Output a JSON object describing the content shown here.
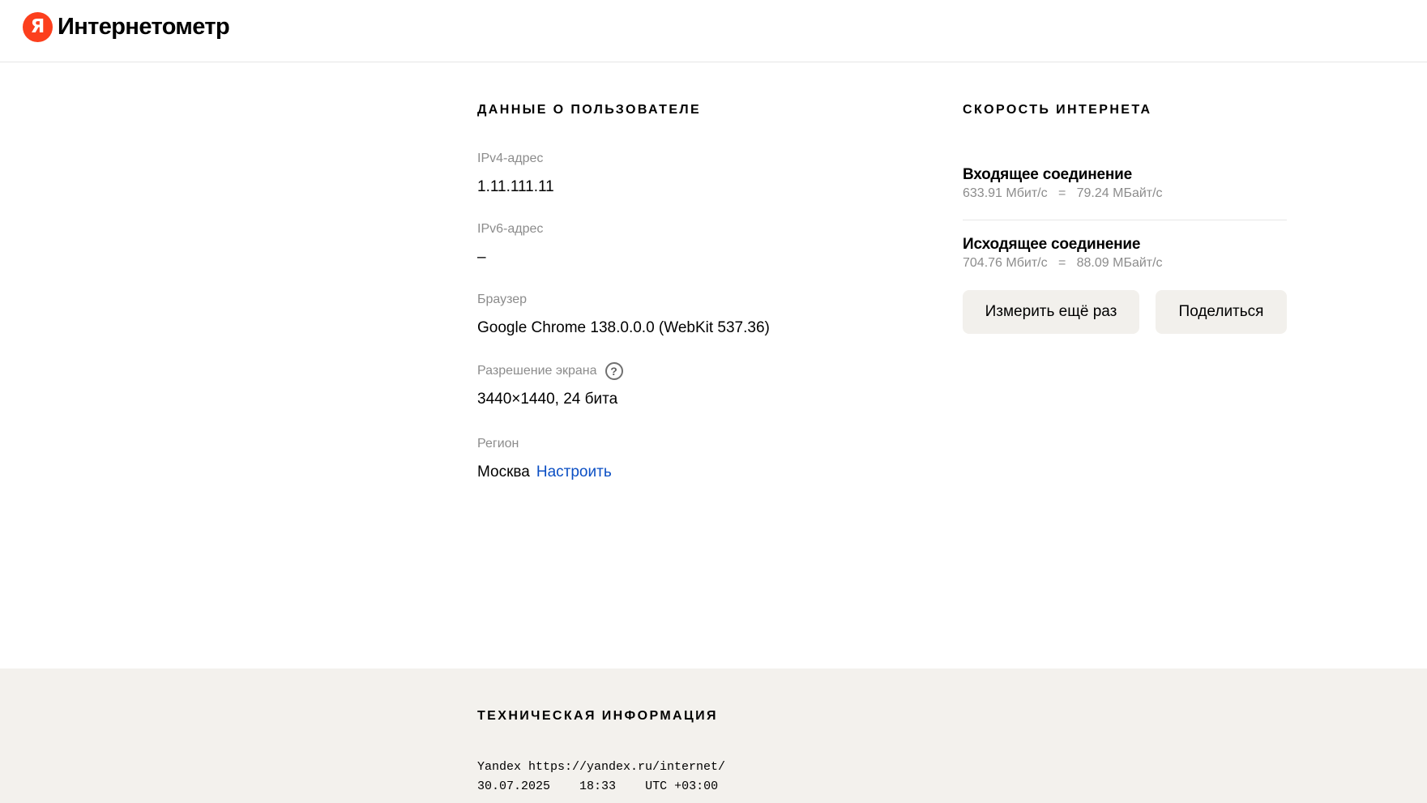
{
  "header": {
    "logo_letter": "Я",
    "title": "Интернетометр"
  },
  "user": {
    "section_title": "ДАННЫЕ О ПОЛЬЗОВАТЕЛЕ",
    "fields": [
      {
        "label": "IPv4-адрес",
        "value": "1.11.111.11"
      },
      {
        "label": "IPv6-адрес",
        "value": "–"
      },
      {
        "label": "Браузер",
        "value": "Google Chrome 138.0.0.0 (WebKit 537.36)"
      },
      {
        "label": "Разрешение экрана",
        "value": "3440×1440, 24 бита",
        "help_icon": "?"
      },
      {
        "label": "Регион",
        "value": "Москва",
        "link": "Настроить"
      }
    ]
  },
  "speed": {
    "section_title": "СКОРОСТЬ ИНТЕРНЕТА",
    "incoming": {
      "name": "Входящее соединение",
      "mbit": "633.91 Мбит/с",
      "separator": "=",
      "mbyte": "79.24 МБайт/с"
    },
    "outgoing": {
      "name": "Исходящее соединение",
      "mbit": "704.76 Мбит/с",
      "separator": "=",
      "mbyte": "88.09 МБайт/с"
    },
    "measure_again_label": "Измерить ещё раз",
    "share_label": "Поделиться"
  },
  "footer": {
    "section_title": "ТЕХНИЧЕСКАЯ ИНФОРМАЦИЯ",
    "line1": "Yandex https://yandex.ru/internet/",
    "date": "30.07.2025",
    "time": "18:33",
    "timezone": "UTC +03:00"
  },
  "colors": {
    "brand": "#fc3f1d",
    "link": "#0b4fc4",
    "button_bg": "#f2f0ec",
    "footer_bg": "#f3f1ed",
    "label_gray": "#8c8c8c"
  },
  "icons": {
    "logo": "yandex-logo-icon",
    "help": "question-circle-icon"
  }
}
